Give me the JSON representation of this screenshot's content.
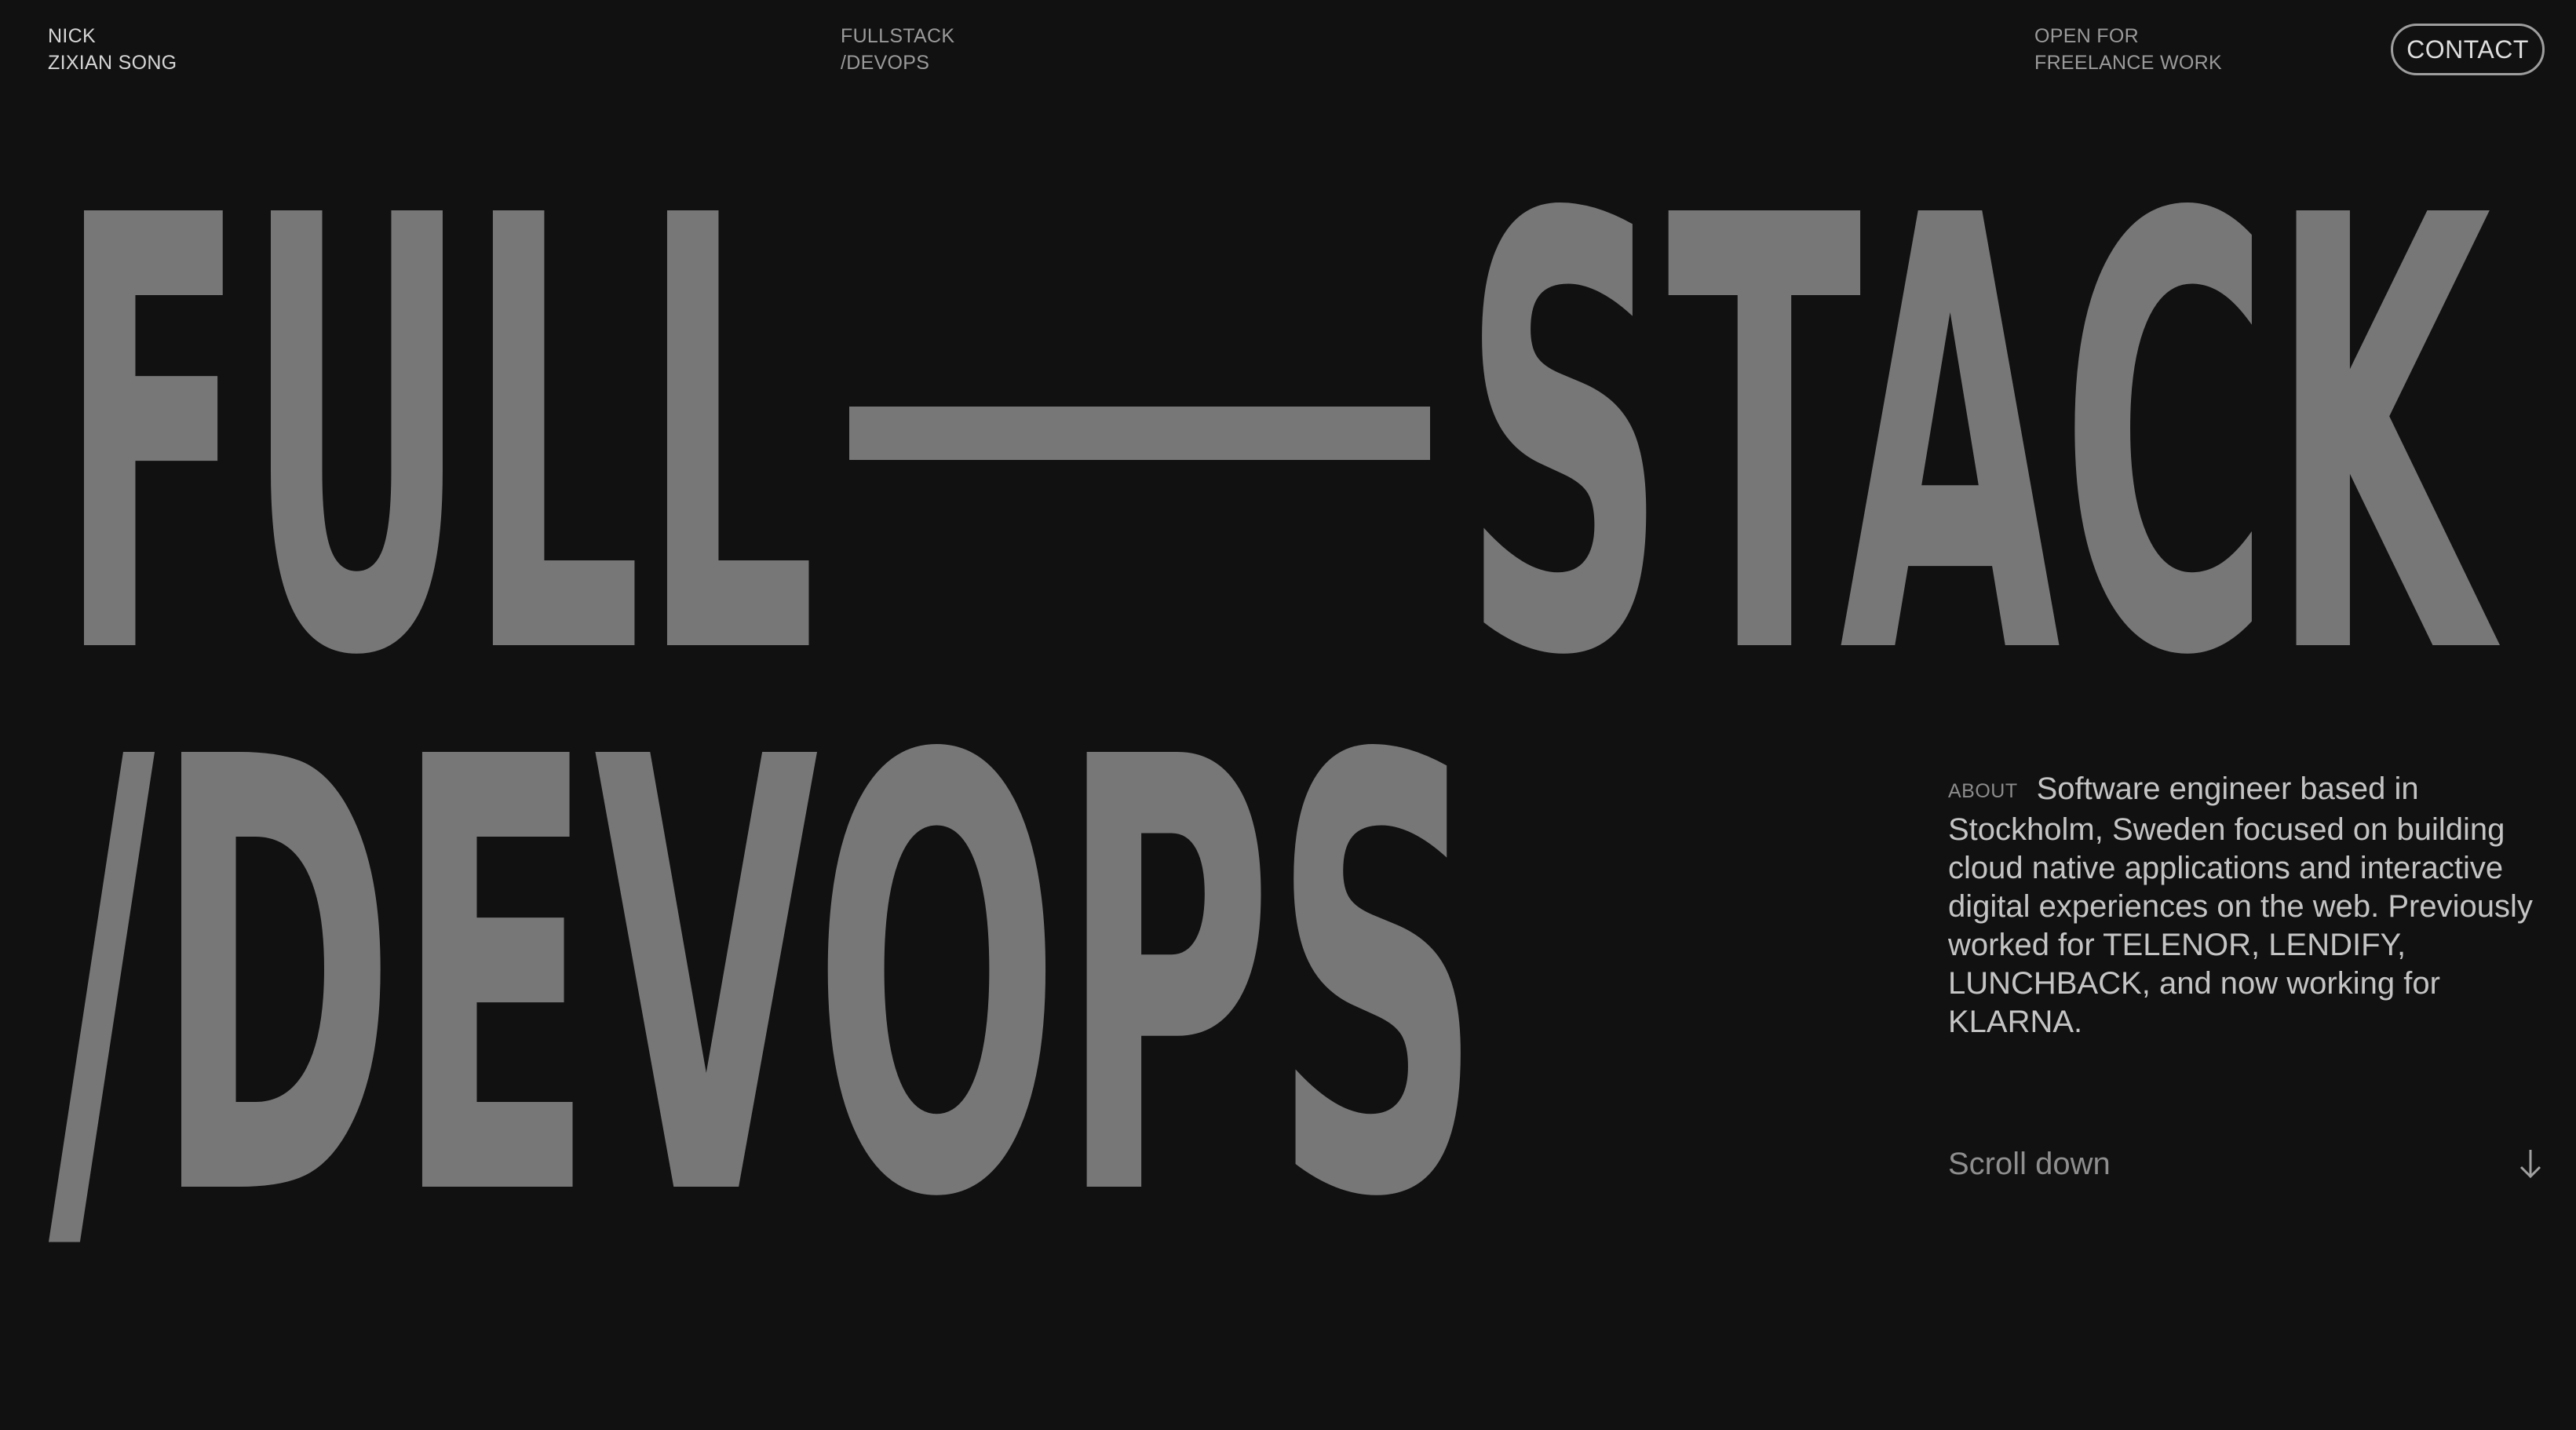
{
  "header": {
    "name_line1": "NICK",
    "name_line2": "ZIXIAN SONG",
    "role_line1": "FULLSTACK",
    "role_line2": "/DEVOPS",
    "status_line1": "OPEN FOR",
    "status_line2": "FREELANCE WORK",
    "contact_label": "CONTACT"
  },
  "hero": {
    "line1_left": "FULL",
    "line1_right": "STACK",
    "line2": "/DEVOPS",
    "dash_icon": "em-dash",
    "text_color": "#777777"
  },
  "about": {
    "label": "ABOUT",
    "text": "Software engineer based in Stockholm, Sweden focused on building cloud native applications and interactive digital experiences on the web. Previously worked for TELENOR, LENDIFY, LUNCHBACK, and now working for KLARNA."
  },
  "scroll": {
    "label": "Scroll down",
    "icon": "arrow-down-icon"
  },
  "colors": {
    "background": "#111111",
    "hero_text": "#777777",
    "body_text": "#c4c4c4",
    "muted_text": "#8e8e8e"
  }
}
